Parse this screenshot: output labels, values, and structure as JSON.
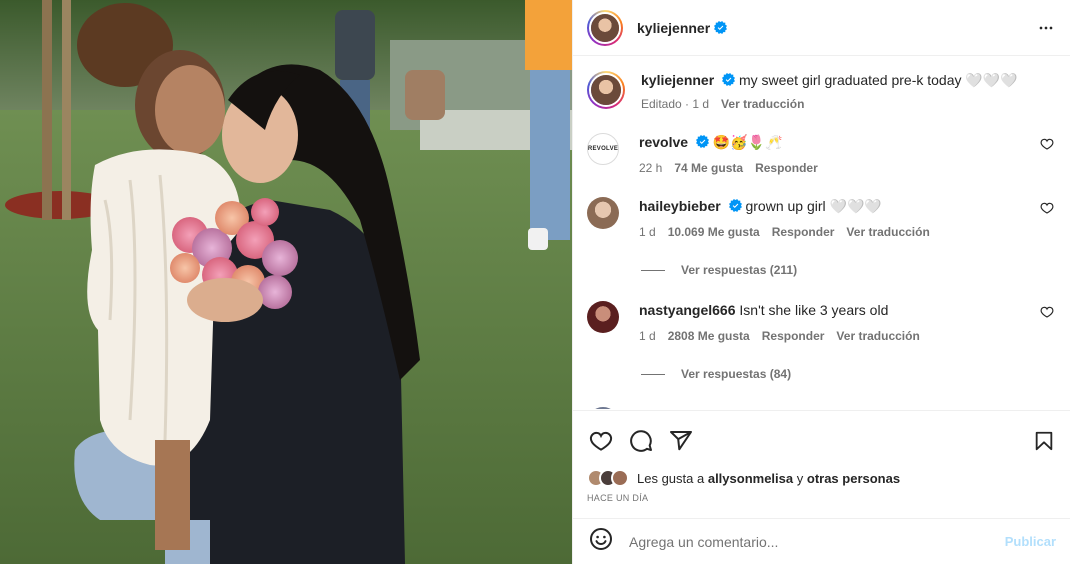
{
  "post": {
    "author": "kyliejenner",
    "caption": "my sweet girl graduated pre-k today 🤍🤍🤍",
    "caption_meta": {
      "edited": "Editado · 1 d",
      "translate": "Ver traducción"
    }
  },
  "comments": [
    {
      "user": "revolve",
      "text": "🤩🥳🌷🥂",
      "time": "22 h",
      "likes": "74 Me gusta",
      "reply": "Responder",
      "translate": ""
    },
    {
      "user": "haileybieber",
      "text": "grown up girl 🤍🤍🤍",
      "time": "1 d",
      "likes": "10.069 Me gusta",
      "reply": "Responder",
      "translate": "Ver traducción",
      "view_replies": "Ver respuestas (211)"
    },
    {
      "user": "nastyangel666",
      "text": "Isn't she like 3 years old",
      "time": "1 d",
      "likes": "2808 Me gusta",
      "reply": "Responder",
      "translate": "Ver traducción",
      "view_replies": "Ver respuestas (84)"
    }
  ],
  "likes": {
    "prefix": "Les gusta a",
    "user": "allysonmelisa",
    "joiner": "y",
    "others": "otras personas"
  },
  "time_ago": "HACE UN DÍA",
  "composer": {
    "placeholder": "Agrega un comentario...",
    "post_label": "Publicar"
  },
  "icons": [
    "heart-icon",
    "comment-icon",
    "share-icon",
    "bookmark-icon",
    "more-icon",
    "emoji-icon",
    "verified-icon"
  ]
}
